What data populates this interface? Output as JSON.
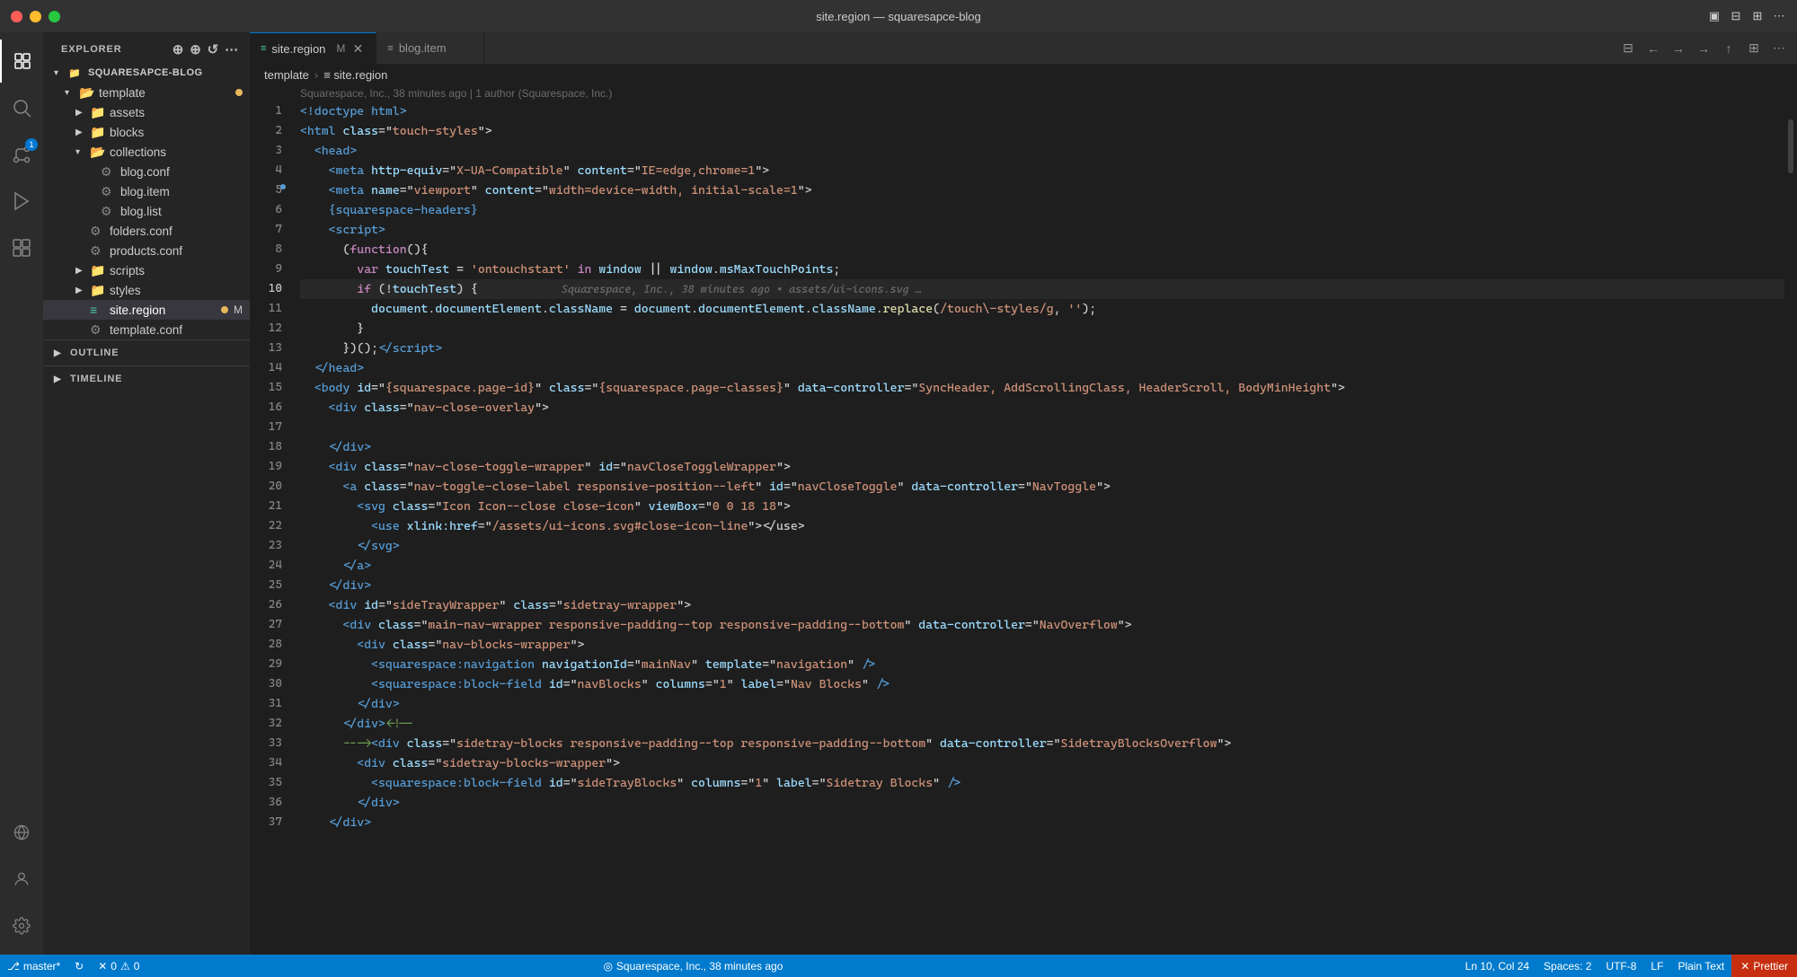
{
  "window": {
    "title": "site.region — squaresapce-blog"
  },
  "titlebar": {
    "traffic": [
      "close",
      "minimize",
      "maximize"
    ],
    "icons": [
      "⊞",
      "⊟",
      "⊠",
      "⊞"
    ]
  },
  "activity_bar": {
    "items": [
      {
        "name": "explorer",
        "icon": "📄",
        "active": true
      },
      {
        "name": "search",
        "icon": "🔍",
        "active": false
      },
      {
        "name": "source-control",
        "icon": "⑂",
        "active": false,
        "badge": "1"
      },
      {
        "name": "run",
        "icon": "▶",
        "active": false
      },
      {
        "name": "extensions",
        "icon": "⊞",
        "active": false
      }
    ],
    "bottom": [
      {
        "name": "remote",
        "icon": "⌂"
      },
      {
        "name": "account",
        "icon": "👤"
      },
      {
        "name": "settings",
        "icon": "⚙"
      }
    ]
  },
  "sidebar": {
    "header": "EXPLORER",
    "root": "SQUARESAPCE-BLOG",
    "tree": [
      {
        "label": "template",
        "type": "folder",
        "expanded": true,
        "indent": 1,
        "modified": true
      },
      {
        "label": "assets",
        "type": "folder",
        "expanded": false,
        "indent": 2
      },
      {
        "label": "blocks",
        "type": "folder",
        "expanded": false,
        "indent": 2
      },
      {
        "label": "collections",
        "type": "folder",
        "expanded": true,
        "indent": 2
      },
      {
        "label": "blog.conf",
        "type": "file",
        "indent": 3
      },
      {
        "label": "blog.item",
        "type": "file",
        "indent": 3
      },
      {
        "label": "blog.list",
        "type": "file",
        "indent": 3
      },
      {
        "label": "folders.conf",
        "type": "file-gear",
        "indent": 2
      },
      {
        "label": "products.conf",
        "type": "file-gear",
        "indent": 2
      },
      {
        "label": "scripts",
        "type": "folder",
        "expanded": false,
        "indent": 2
      },
      {
        "label": "styles",
        "type": "folder",
        "expanded": false,
        "indent": 2
      },
      {
        "label": "site.region",
        "type": "file-active",
        "indent": 2,
        "modified": true
      },
      {
        "label": "template.conf",
        "type": "file-gear",
        "indent": 2
      }
    ],
    "outline": "OUTLINE",
    "timeline": "TIMELINE"
  },
  "tabs": [
    {
      "label": "site.region",
      "icon": "≡",
      "active": true,
      "modified": true,
      "closable": true
    },
    {
      "label": "blog.item",
      "icon": "≡",
      "active": false,
      "closable": false
    }
  ],
  "breadcrumb": {
    "parts": [
      "template",
      "site.region"
    ]
  },
  "blame": {
    "text": "Squarespace, Inc., 38 minutes ago | 1 author (Squarespace, Inc.)"
  },
  "code": {
    "lines": [
      {
        "num": 1,
        "content": "<!doctype html>"
      },
      {
        "num": 2,
        "content": "<html class=\"touch-styles\">"
      },
      {
        "num": 3,
        "content": "  <head>"
      },
      {
        "num": 4,
        "content": "    <meta http-equiv=\"X-UA-Compatible\" content=\"IE=edge,chrome=1\">"
      },
      {
        "num": 5,
        "content": "    <meta name=\"viewport\" content=\"width=device-width, initial-scale=1\">"
      },
      {
        "num": 6,
        "content": "    {squarespace-headers}"
      },
      {
        "num": 7,
        "content": "    <script>"
      },
      {
        "num": 8,
        "content": "      (function(){"
      },
      {
        "num": 9,
        "content": "        var touchTest = 'ontouchstart' in window || window.msMaxTouchPoints;"
      },
      {
        "num": 10,
        "content": "        if (!touchTest) {",
        "hint": "Squarespace, Inc., 38 minutes ago • assets/ui-icons.svg …",
        "active": true
      },
      {
        "num": 11,
        "content": "          document.documentElement.className = document.documentElement.className.replace(/touch\\-styles/g, '');"
      },
      {
        "num": 12,
        "content": "        }"
      },
      {
        "num": 13,
        "content": "      })();<\\/script>"
      },
      {
        "num": 14,
        "content": "  </head>"
      },
      {
        "num": 15,
        "content": "  <body id=\"{squarespace.page-id}\" class=\"{squarespace.page-classes}\" data-controller=\"SyncHeader, AddScrollingClass, HeaderScroll, BodyMinHeight\">"
      },
      {
        "num": 16,
        "content": "    <div class=\"nav-close-overlay\">"
      },
      {
        "num": 17,
        "content": ""
      },
      {
        "num": 18,
        "content": "    </div>"
      },
      {
        "num": 19,
        "content": "    <div class=\"nav-close-toggle-wrapper\" id=\"navCloseToggleWrapper\">"
      },
      {
        "num": 20,
        "content": "      <a class=\"nav-toggle-close-label responsive-position--left\" id=\"navCloseToggle\" data-controller=\"NavToggle\">"
      },
      {
        "num": 21,
        "content": "        <svg class=\"Icon Icon--close close-icon\" viewBox=\"0 0 18 18\">"
      },
      {
        "num": 22,
        "content": "          <use xlink:href=\"/assets/ui-icons.svg#close-icon-line\"></use>"
      },
      {
        "num": 23,
        "content": "        </svg>"
      },
      {
        "num": 24,
        "content": "      </a>"
      },
      {
        "num": 25,
        "content": "    </div>"
      },
      {
        "num": 26,
        "content": "    <div id=\"sideTrayWrapper\" class=\"sidetray-wrapper\">"
      },
      {
        "num": 27,
        "content": "      <div class=\"main-nav-wrapper responsive-padding--top responsive-padding--bottom\" data-controller=\"NavOverflow\">"
      },
      {
        "num": 28,
        "content": "        <div class=\"nav-blocks-wrapper\">"
      },
      {
        "num": 29,
        "content": "          <squarespace:navigation navigationId=\"mainNav\" template=\"navigation\" />"
      },
      {
        "num": 30,
        "content": "          <squarespace:block-field id=\"navBlocks\" columns=\"1\" label=\"Nav Blocks\" />"
      },
      {
        "num": 31,
        "content": "        </div>"
      },
      {
        "num": 32,
        "content": "      </div><!--"
      },
      {
        "num": 33,
        "content": "      ---><div class=\"sidetray-blocks responsive-padding--top responsive-padding--bottom\" data-controller=\"SidetrayBlocksOverflow\">"
      },
      {
        "num": 34,
        "content": "        <div class=\"sidetray-blocks-wrapper\">"
      },
      {
        "num": 35,
        "content": "          <squarespace:block-field id=\"sideTrayBlocks\" columns=\"1\" label=\"Sidetray Blocks\" />"
      },
      {
        "num": 36,
        "content": "        </div>"
      },
      {
        "num": 37,
        "content": "    </div>"
      }
    ]
  },
  "status_bar": {
    "left": [
      {
        "icon": "⎇",
        "text": "master*"
      },
      {
        "icon": "↻",
        "text": ""
      },
      {
        "icon": "⇄",
        "text": ""
      },
      {
        "icon": "⚠",
        "text": "0"
      },
      {
        "icon": "✕",
        "text": "0"
      }
    ],
    "center": {
      "icon": "◎",
      "text": "Squarespace, Inc., 38 minutes ago"
    },
    "right": [
      {
        "text": "Ln 10, Col 24"
      },
      {
        "text": "Spaces: 2"
      },
      {
        "text": "UTF-8"
      },
      {
        "text": "LF"
      },
      {
        "text": "Plain Text"
      },
      {
        "text": "✕ Prettier",
        "type": "error"
      }
    ]
  }
}
